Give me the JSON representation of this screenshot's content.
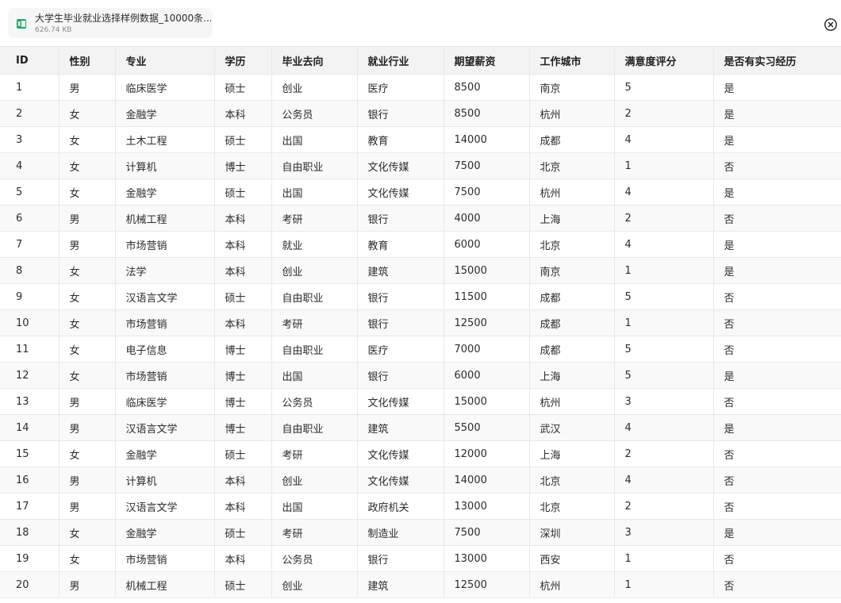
{
  "file": {
    "name": "大学生毕业就业选择样例数据_10000条....",
    "size": "626.74 KB",
    "icon": "spreadsheet-file-icon",
    "icon_color": "#21a366"
  },
  "close": {
    "icon": "close-circle-icon"
  },
  "table": {
    "columns": [
      "ID",
      "性别",
      "专业",
      "学历",
      "毕业去向",
      "就业行业",
      "期望薪资",
      "工作城市",
      "满意度评分",
      "是否有实习经历"
    ],
    "rows": [
      [
        "1",
        "男",
        "临床医学",
        "硕士",
        "创业",
        "医疗",
        "8500",
        "南京",
        "5",
        "是"
      ],
      [
        "2",
        "女",
        "金融学",
        "本科",
        "公务员",
        "银行",
        "8500",
        "杭州",
        "2",
        "是"
      ],
      [
        "3",
        "女",
        "土木工程",
        "硕士",
        "出国",
        "教育",
        "14000",
        "成都",
        "4",
        "是"
      ],
      [
        "4",
        "女",
        "计算机",
        "博士",
        "自由职业",
        "文化传媒",
        "7500",
        "北京",
        "1",
        "否"
      ],
      [
        "5",
        "女",
        "金融学",
        "硕士",
        "出国",
        "文化传媒",
        "7500",
        "杭州",
        "4",
        "是"
      ],
      [
        "6",
        "男",
        "机械工程",
        "本科",
        "考研",
        "银行",
        "4000",
        "上海",
        "2",
        "否"
      ],
      [
        "7",
        "男",
        "市场营销",
        "本科",
        "就业",
        "教育",
        "6000",
        "北京",
        "4",
        "是"
      ],
      [
        "8",
        "女",
        "法学",
        "本科",
        "创业",
        "建筑",
        "15000",
        "南京",
        "1",
        "是"
      ],
      [
        "9",
        "女",
        "汉语言文学",
        "硕士",
        "自由职业",
        "银行",
        "11500",
        "成都",
        "5",
        "否"
      ],
      [
        "10",
        "女",
        "市场营销",
        "本科",
        "考研",
        "银行",
        "12500",
        "成都",
        "1",
        "否"
      ],
      [
        "11",
        "女",
        "电子信息",
        "博士",
        "自由职业",
        "医疗",
        "7000",
        "成都",
        "5",
        "否"
      ],
      [
        "12",
        "女",
        "市场营销",
        "博士",
        "出国",
        "银行",
        "6000",
        "上海",
        "5",
        "是"
      ],
      [
        "13",
        "男",
        "临床医学",
        "博士",
        "公务员",
        "文化传媒",
        "15000",
        "杭州",
        "3",
        "否"
      ],
      [
        "14",
        "男",
        "汉语言文学",
        "博士",
        "自由职业",
        "建筑",
        "5500",
        "武汉",
        "4",
        "是"
      ],
      [
        "15",
        "女",
        "金融学",
        "硕士",
        "考研",
        "文化传媒",
        "12000",
        "上海",
        "2",
        "否"
      ],
      [
        "16",
        "男",
        "计算机",
        "本科",
        "创业",
        "文化传媒",
        "14000",
        "北京",
        "4",
        "否"
      ],
      [
        "17",
        "男",
        "汉语言文学",
        "本科",
        "出国",
        "政府机关",
        "13000",
        "北京",
        "2",
        "否"
      ],
      [
        "18",
        "女",
        "金融学",
        "硕士",
        "考研",
        "制造业",
        "7500",
        "深圳",
        "3",
        "是"
      ],
      [
        "19",
        "女",
        "市场营销",
        "本科",
        "公务员",
        "银行",
        "13000",
        "西安",
        "1",
        "否"
      ],
      [
        "20",
        "男",
        "机械工程",
        "硕士",
        "创业",
        "建筑",
        "12500",
        "杭州",
        "1",
        "否"
      ]
    ]
  }
}
